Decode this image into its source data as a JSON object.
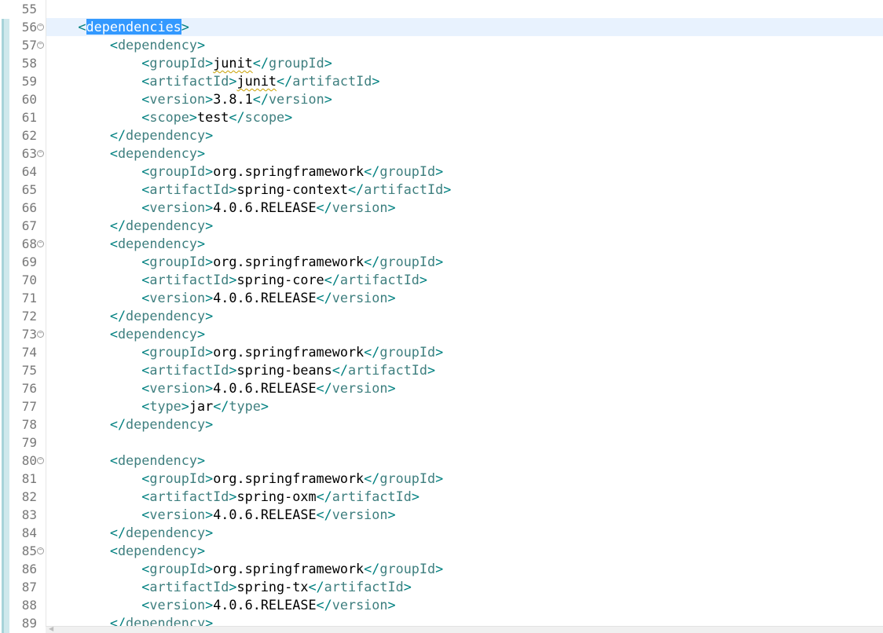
{
  "editor": {
    "language": "xml",
    "current_line": 56,
    "selection": "dependencies",
    "lines": [
      {
        "number": "55",
        "fold": false,
        "indent": 0,
        "tag": "",
        "close": false,
        "value": ""
      },
      {
        "number": "56",
        "fold": true,
        "indent": 1,
        "tag": "dependencies",
        "close": false,
        "value": ""
      },
      {
        "number": "57",
        "fold": true,
        "indent": 2,
        "tag": "dependency",
        "close": false,
        "value": ""
      },
      {
        "number": "58",
        "fold": false,
        "indent": 3,
        "tag": "groupId",
        "value": "junit",
        "close": true
      },
      {
        "number": "59",
        "fold": false,
        "indent": 3,
        "tag": "artifactId",
        "value": "junit",
        "close": true
      },
      {
        "number": "60",
        "fold": false,
        "indent": 3,
        "tag": "version",
        "value": "3.8.1",
        "close": true
      },
      {
        "number": "61",
        "fold": false,
        "indent": 3,
        "tag": "scope",
        "value": "test",
        "close": true
      },
      {
        "number": "62",
        "fold": false,
        "indent": 2,
        "tag": "/dependency",
        "close": false,
        "value": ""
      },
      {
        "number": "63",
        "fold": true,
        "indent": 2,
        "tag": "dependency",
        "close": false,
        "value": ""
      },
      {
        "number": "64",
        "fold": false,
        "indent": 3,
        "tag": "groupId",
        "value": "org.springframework",
        "close": true
      },
      {
        "number": "65",
        "fold": false,
        "indent": 3,
        "tag": "artifactId",
        "value": "spring-context",
        "close": true
      },
      {
        "number": "66",
        "fold": false,
        "indent": 3,
        "tag": "version",
        "value": "4.0.6.RELEASE",
        "close": true
      },
      {
        "number": "67",
        "fold": false,
        "indent": 2,
        "tag": "/dependency",
        "close": false,
        "value": ""
      },
      {
        "number": "68",
        "fold": true,
        "indent": 2,
        "tag": "dependency",
        "close": false,
        "value": ""
      },
      {
        "number": "69",
        "fold": false,
        "indent": 3,
        "tag": "groupId",
        "value": "org.springframework",
        "close": true
      },
      {
        "number": "70",
        "fold": false,
        "indent": 3,
        "tag": "artifactId",
        "value": "spring-core",
        "close": true
      },
      {
        "number": "71",
        "fold": false,
        "indent": 3,
        "tag": "version",
        "value": "4.0.6.RELEASE",
        "close": true
      },
      {
        "number": "72",
        "fold": false,
        "indent": 2,
        "tag": "/dependency",
        "close": false,
        "value": ""
      },
      {
        "number": "73",
        "fold": true,
        "indent": 2,
        "tag": "dependency",
        "close": false,
        "value": ""
      },
      {
        "number": "74",
        "fold": false,
        "indent": 3,
        "tag": "groupId",
        "value": "org.springframework",
        "close": true
      },
      {
        "number": "75",
        "fold": false,
        "indent": 3,
        "tag": "artifactId",
        "value": "spring-beans",
        "close": true
      },
      {
        "number": "76",
        "fold": false,
        "indent": 3,
        "tag": "version",
        "value": "4.0.6.RELEASE",
        "close": true
      },
      {
        "number": "77",
        "fold": false,
        "indent": 3,
        "tag": "type",
        "value": "jar",
        "close": true
      },
      {
        "number": "78",
        "fold": false,
        "indent": 2,
        "tag": "/dependency",
        "close": false,
        "value": ""
      },
      {
        "number": "79",
        "fold": false,
        "indent": 0,
        "tag": "",
        "close": false,
        "value": ""
      },
      {
        "number": "80",
        "fold": true,
        "indent": 2,
        "tag": "dependency",
        "close": false,
        "value": ""
      },
      {
        "number": "81",
        "fold": false,
        "indent": 3,
        "tag": "groupId",
        "value": "org.springframework",
        "close": true
      },
      {
        "number": "82",
        "fold": false,
        "indent": 3,
        "tag": "artifactId",
        "value": "spring-oxm",
        "close": true
      },
      {
        "number": "83",
        "fold": false,
        "indent": 3,
        "tag": "version",
        "value": "4.0.6.RELEASE",
        "close": true
      },
      {
        "number": "84",
        "fold": false,
        "indent": 2,
        "tag": "/dependency",
        "close": false,
        "value": ""
      },
      {
        "number": "85",
        "fold": true,
        "indent": 2,
        "tag": "dependency",
        "close": false,
        "value": ""
      },
      {
        "number": "86",
        "fold": false,
        "indent": 3,
        "tag": "groupId",
        "value": "org.springframework",
        "close": true
      },
      {
        "number": "87",
        "fold": false,
        "indent": 3,
        "tag": "artifactId",
        "value": "spring-tx",
        "close": true
      },
      {
        "number": "88",
        "fold": false,
        "indent": 3,
        "tag": "version",
        "value": "4.0.6.RELEASE",
        "close": true
      },
      {
        "number": "89",
        "fold": false,
        "indent": 2,
        "tag": "/dependency",
        "close": false,
        "value": ""
      }
    ],
    "spell_flagged": [
      "junit"
    ]
  },
  "colors": {
    "bracket": "#008080",
    "tag_name": "#3f7f7f",
    "text": "#000000",
    "selection": "#3399ff",
    "current_line": "#e8f2fe",
    "line_number": "#787878",
    "change_bar": "#a7d3d9"
  },
  "icons": {
    "fold": "fold-collapse-icon",
    "scroll_left": "scroll-left-arrow-icon"
  }
}
